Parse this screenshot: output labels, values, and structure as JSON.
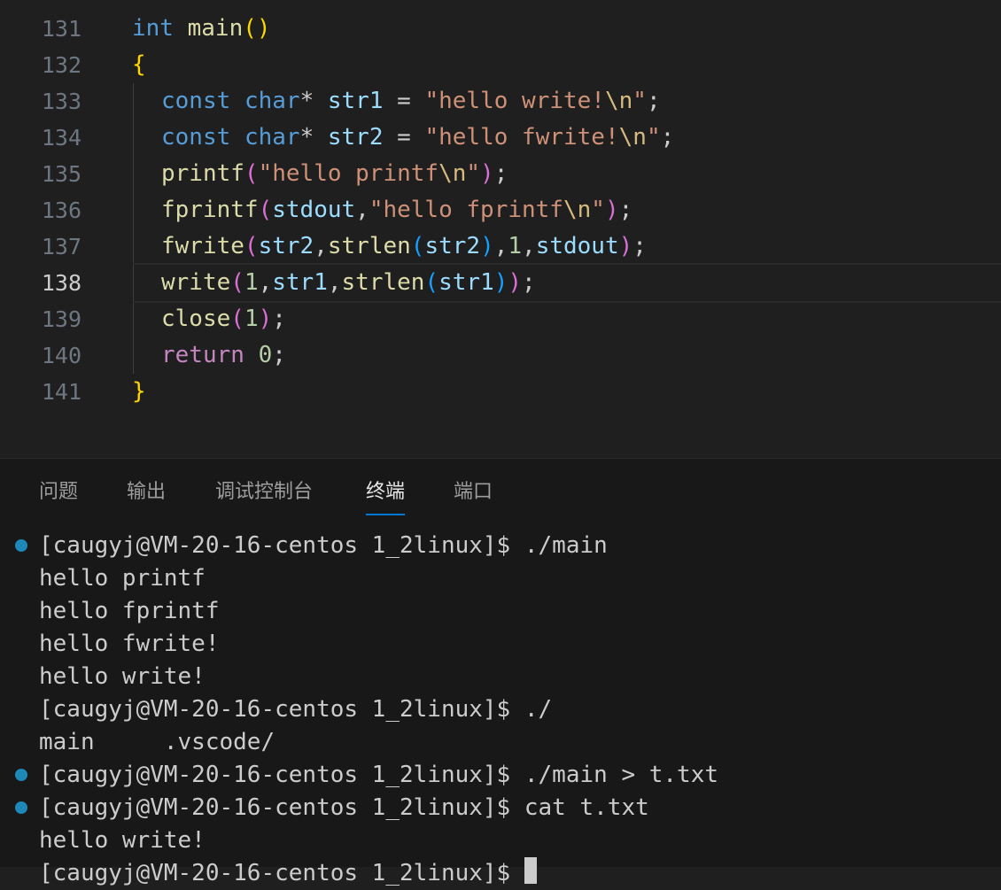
{
  "editor": {
    "lines": [
      {
        "num": "131",
        "tokens": [
          [
            "kw",
            "int"
          ],
          [
            "pn",
            " "
          ],
          [
            "fn",
            "main"
          ],
          [
            "b1",
            "()"
          ]
        ]
      },
      {
        "num": "132",
        "tokens": [
          [
            "b1",
            "{"
          ]
        ]
      },
      {
        "num": "133",
        "tokens": [
          [
            "kw",
            "const"
          ],
          [
            "pn",
            " "
          ],
          [
            "kw",
            "char"
          ],
          [
            "pn",
            "* "
          ],
          [
            "var",
            "str1"
          ],
          [
            "pn",
            " = "
          ],
          [
            "str",
            "\"hello write!"
          ],
          [
            "esc",
            "\\n"
          ],
          [
            "str",
            "\""
          ],
          [
            "pn",
            ";"
          ]
        ]
      },
      {
        "num": "134",
        "tokens": [
          [
            "kw",
            "const"
          ],
          [
            "pn",
            " "
          ],
          [
            "kw",
            "char"
          ],
          [
            "pn",
            "* "
          ],
          [
            "var",
            "str2"
          ],
          [
            "pn",
            " = "
          ],
          [
            "str",
            "\"hello fwrite!"
          ],
          [
            "esc",
            "\\n"
          ],
          [
            "str",
            "\""
          ],
          [
            "pn",
            ";"
          ]
        ]
      },
      {
        "num": "135",
        "tokens": [
          [
            "fn",
            "printf"
          ],
          [
            "b2",
            "("
          ],
          [
            "str",
            "\"hello printf"
          ],
          [
            "esc",
            "\\n"
          ],
          [
            "str",
            "\""
          ],
          [
            "b2",
            ")"
          ],
          [
            "pn",
            ";"
          ]
        ]
      },
      {
        "num": "136",
        "tokens": [
          [
            "fn",
            "fprintf"
          ],
          [
            "b2",
            "("
          ],
          [
            "var",
            "stdout"
          ],
          [
            "pn",
            ","
          ],
          [
            "str",
            "\"hello fprintf"
          ],
          [
            "esc",
            "\\n"
          ],
          [
            "str",
            "\""
          ],
          [
            "b2",
            ")"
          ],
          [
            "pn",
            ";"
          ]
        ]
      },
      {
        "num": "137",
        "tokens": [
          [
            "fn",
            "fwrite"
          ],
          [
            "b2",
            "("
          ],
          [
            "var",
            "str2"
          ],
          [
            "pn",
            ","
          ],
          [
            "fn",
            "strlen"
          ],
          [
            "b3",
            "("
          ],
          [
            "var",
            "str2"
          ],
          [
            "b3",
            ")"
          ],
          [
            "pn",
            ","
          ],
          [
            "num",
            "1"
          ],
          [
            "pn",
            ","
          ],
          [
            "var",
            "stdout"
          ],
          [
            "b2",
            ")"
          ],
          [
            "pn",
            ";"
          ]
        ]
      },
      {
        "num": "138",
        "tokens": [
          [
            "fn",
            "write"
          ],
          [
            "b2",
            "("
          ],
          [
            "num",
            "1"
          ],
          [
            "pn",
            ","
          ],
          [
            "var",
            "str1"
          ],
          [
            "pn",
            ","
          ],
          [
            "fn",
            "strlen"
          ],
          [
            "b3",
            "("
          ],
          [
            "var",
            "str1"
          ],
          [
            "b3",
            ")"
          ],
          [
            "b2",
            ")"
          ],
          [
            "pn",
            ";"
          ]
        ]
      },
      {
        "num": "139",
        "tokens": [
          [
            "fn",
            "close"
          ],
          [
            "b2",
            "("
          ],
          [
            "num",
            "1"
          ],
          [
            "b2",
            ")"
          ],
          [
            "pn",
            ";"
          ]
        ]
      },
      {
        "num": "140",
        "tokens": [
          [
            "ctl",
            "return"
          ],
          [
            "pn",
            " "
          ],
          [
            "num",
            "0"
          ],
          [
            "pn",
            ";"
          ]
        ]
      },
      {
        "num": "141",
        "tokens": [
          [
            "b1",
            "}"
          ]
        ]
      }
    ]
  },
  "panel": {
    "tabs": [
      "问题",
      "输出",
      "调试控制台",
      "终端",
      "端口"
    ],
    "active_tab": "终端"
  },
  "terminal": {
    "lines": [
      {
        "text": "[caugyj@VM-20-16-centos 1_2linux]$ ./main",
        "dot": true
      },
      {
        "text": "hello printf",
        "dot": false
      },
      {
        "text": "hello fprintf",
        "dot": false
      },
      {
        "text": "hello fwrite!",
        "dot": false
      },
      {
        "text": "hello write!",
        "dot": false
      },
      {
        "text": "[caugyj@VM-20-16-centos 1_2linux]$ ./",
        "dot": false
      },
      {
        "text": "main     .vscode/",
        "dot": false
      },
      {
        "text": "[caugyj@VM-20-16-centos 1_2linux]$ ./main > t.txt",
        "dot": true
      },
      {
        "text": "[caugyj@VM-20-16-centos 1_2linux]$ cat t.txt",
        "dot": true
      },
      {
        "text": "hello write!",
        "dot": false
      },
      {
        "text": "[caugyj@VM-20-16-centos 1_2linux]$ ",
        "dot": false
      }
    ]
  },
  "colors": {
    "accent": "#0078d4",
    "status_dot": "#1e88b9"
  }
}
